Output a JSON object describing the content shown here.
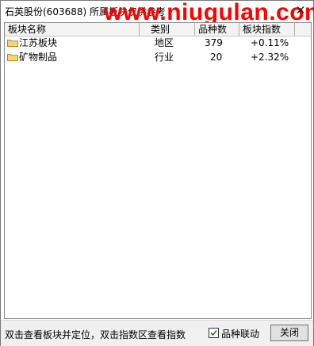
{
  "window": {
    "title": "石英股份(603688)  所属板块仅供参考",
    "watermark": "www.niugulan.com",
    "close_glyph": "✕"
  },
  "table": {
    "columns": [
      "板块名称",
      "类别",
      "品种数",
      "板块指数"
    ],
    "rows": [
      {
        "name": "江苏板块",
        "category": "地区",
        "count": "379",
        "change": "+0.11%",
        "icon": "folder-icon"
      },
      {
        "name": "矿物制品",
        "category": "行业",
        "count": "20",
        "change": "+2.32%",
        "icon": "folder-icon"
      }
    ]
  },
  "status": {
    "hint": "双击查看板块并定位，双击指数区查看指数",
    "checkbox_label": "品种联动",
    "checkbox_checked": true,
    "close_button": "关闭"
  },
  "colors": {
    "watermark": "#ff0000",
    "folder": "#f5d77a",
    "checkmark": "#1b8a1b"
  }
}
